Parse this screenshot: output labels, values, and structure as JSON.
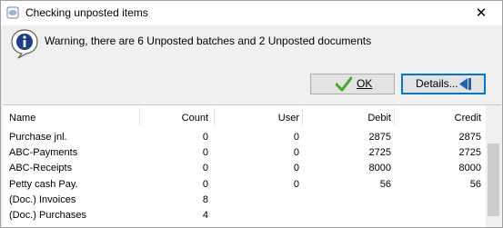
{
  "window": {
    "title": "Checking unposted items",
    "close_glyph": "✕"
  },
  "message": {
    "icon": "info-icon",
    "text": "Warning, there are 6 Unposted batches and 2 Unposted documents"
  },
  "buttons": {
    "ok_label": "OK",
    "details_label": "Details...",
    "ok_icon": "checkmark-icon",
    "details_icon": "arrow-left-icon"
  },
  "grid": {
    "columns": [
      "Name",
      "Count",
      "User",
      "Debit",
      "Credit"
    ],
    "rows": [
      [
        "Purchase jnl.",
        "0",
        "0",
        "2875",
        "2875"
      ],
      [
        "ABC-Payments",
        "0",
        "0",
        "2725",
        "2725"
      ],
      [
        "ABC-Receipts",
        "0",
        "0",
        "8000",
        "8000"
      ],
      [
        "Petty cash Pay.",
        "0",
        "0",
        "56",
        "56"
      ],
      [
        "(Doc.) Invoices",
        "8",
        "",
        "",
        ""
      ],
      [
        "(Doc.) Purchases",
        "4",
        "",
        "",
        ""
      ]
    ]
  },
  "colors": {
    "check_green": "#3fae29",
    "arrow_blue": "#1f5fb5",
    "info_blue": "#1e3c8c"
  }
}
